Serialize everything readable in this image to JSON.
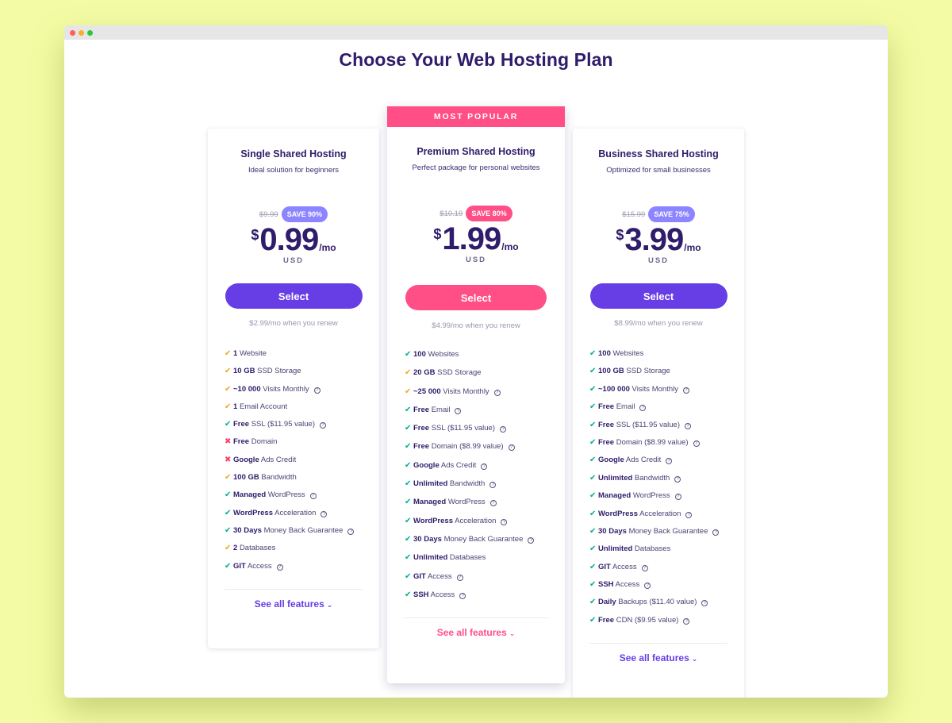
{
  "window": {
    "controls": [
      "close",
      "minimize",
      "maximize"
    ]
  },
  "page_title": "Choose Your Web Hosting Plan",
  "icons": {
    "check": "✔",
    "cross": "✖",
    "help": "?",
    "chevron_down": "⌄"
  },
  "colors": {
    "primary": "#673de6",
    "accent_pink": "#ff4f86",
    "check_green": "#00b090",
    "check_orange": "#f6a623",
    "cross_red": "#ff3f6c",
    "text_dark": "#2f1c6a",
    "page_bg": "#f3fca4"
  },
  "plans": [
    {
      "name": "Single Shared Hosting",
      "description": "Ideal solution for beginners",
      "old_price": "$9.99",
      "save_badge": "SAVE 90%",
      "currency_symbol": "$",
      "price": "0.99",
      "period": "/mo",
      "currency": "USD",
      "select_label": "Select",
      "renew_text": "$2.99/mo when you renew",
      "see_all_label": "See all features",
      "features": [
        {
          "status": "partial",
          "bold": "1",
          "text": "Website",
          "help": false
        },
        {
          "status": "partial",
          "bold": "10 GB",
          "text": "SSD Storage",
          "help": false
        },
        {
          "status": "partial",
          "bold": "~10 000",
          "text": "Visits Monthly",
          "help": true
        },
        {
          "status": "partial",
          "bold": "1",
          "text": "Email Account",
          "help": false
        },
        {
          "status": "included",
          "bold": "Free",
          "text": "SSL ($11.95 value)",
          "help": true
        },
        {
          "status": "excluded",
          "bold": "Free",
          "text": "Domain",
          "help": false
        },
        {
          "status": "excluded",
          "bold": "Google",
          "text": "Ads Credit",
          "help": false
        },
        {
          "status": "partial",
          "bold": "100 GB",
          "text": "Bandwidth",
          "help": false
        },
        {
          "status": "included",
          "bold": "Managed",
          "text": "WordPress",
          "help": true
        },
        {
          "status": "included",
          "bold": "WordPress",
          "text": "Acceleration",
          "help": true
        },
        {
          "status": "included",
          "bold": "30 Days",
          "text": "Money Back Guarantee",
          "help": true
        },
        {
          "status": "partial",
          "bold": "2",
          "text": "Databases",
          "help": false
        },
        {
          "status": "included",
          "bold": "GIT",
          "text": "Access",
          "help": true
        }
      ]
    },
    {
      "ribbon": "MOST POPULAR",
      "name": "Premium Shared Hosting",
      "description": "Perfect package for personal websites",
      "old_price": "$10.19",
      "save_badge": "SAVE 80%",
      "currency_symbol": "$",
      "price": "1.99",
      "period": "/mo",
      "currency": "USD",
      "select_label": "Select",
      "renew_text": "$4.99/mo when you renew",
      "see_all_label": "See all features",
      "features": [
        {
          "status": "included",
          "bold": "100",
          "text": "Websites",
          "help": false
        },
        {
          "status": "partial",
          "bold": "20 GB",
          "text": "SSD Storage",
          "help": false
        },
        {
          "status": "partial",
          "bold": "~25 000",
          "text": "Visits Monthly",
          "help": true
        },
        {
          "status": "included",
          "bold": "Free",
          "text": "Email",
          "help": true
        },
        {
          "status": "included",
          "bold": "Free",
          "text": "SSL ($11.95 value)",
          "help": true
        },
        {
          "status": "included",
          "bold": "Free",
          "text": "Domain ($8.99 value)",
          "help": true
        },
        {
          "status": "included",
          "bold": "Google",
          "text": "Ads Credit",
          "help": true
        },
        {
          "status": "included",
          "bold": "Unlimited",
          "text": "Bandwidth",
          "help": true
        },
        {
          "status": "included",
          "bold": "Managed",
          "text": "WordPress",
          "help": true
        },
        {
          "status": "included",
          "bold": "WordPress",
          "text": "Acceleration",
          "help": true
        },
        {
          "status": "included",
          "bold": "30 Days",
          "text": "Money Back Guarantee",
          "help": true
        },
        {
          "status": "included",
          "bold": "Unlimited",
          "text": "Databases",
          "help": false
        },
        {
          "status": "included",
          "bold": "GIT",
          "text": "Access",
          "help": true
        },
        {
          "status": "included",
          "bold": "SSH",
          "text": "Access",
          "help": true
        }
      ]
    },
    {
      "name": "Business Shared Hosting",
      "description": "Optimized for small businesses",
      "old_price": "$15.99",
      "save_badge": "SAVE 75%",
      "currency_symbol": "$",
      "price": "3.99",
      "period": "/mo",
      "currency": "USD",
      "select_label": "Select",
      "renew_text": "$8.99/mo when you renew",
      "see_all_label": "See all features",
      "features": [
        {
          "status": "included",
          "bold": "100",
          "text": "Websites",
          "help": false
        },
        {
          "status": "included",
          "bold": "100 GB",
          "text": "SSD Storage",
          "help": false
        },
        {
          "status": "included",
          "bold": "~100 000",
          "text": "Visits Monthly",
          "help": true
        },
        {
          "status": "included",
          "bold": "Free",
          "text": "Email",
          "help": true
        },
        {
          "status": "included",
          "bold": "Free",
          "text": "SSL ($11.95 value)",
          "help": true
        },
        {
          "status": "included",
          "bold": "Free",
          "text": "Domain ($8.99 value)",
          "help": true
        },
        {
          "status": "included",
          "bold": "Google",
          "text": "Ads Credit",
          "help": true
        },
        {
          "status": "included",
          "bold": "Unlimited",
          "text": "Bandwidth",
          "help": true
        },
        {
          "status": "included",
          "bold": "Managed",
          "text": "WordPress",
          "help": true
        },
        {
          "status": "included",
          "bold": "WordPress",
          "text": "Acceleration",
          "help": true
        },
        {
          "status": "included",
          "bold": "30 Days",
          "text": "Money Back Guarantee",
          "help": true
        },
        {
          "status": "included",
          "bold": "Unlimited",
          "text": "Databases",
          "help": false
        },
        {
          "status": "included",
          "bold": "GIT",
          "text": "Access",
          "help": true
        },
        {
          "status": "included",
          "bold": "SSH",
          "text": "Access",
          "help": true
        },
        {
          "status": "included",
          "bold": "Daily",
          "text": "Backups ($11.40 value)",
          "help": true
        },
        {
          "status": "included",
          "bold": "Free",
          "text": "CDN ($9.95 value)",
          "help": true
        }
      ]
    }
  ]
}
